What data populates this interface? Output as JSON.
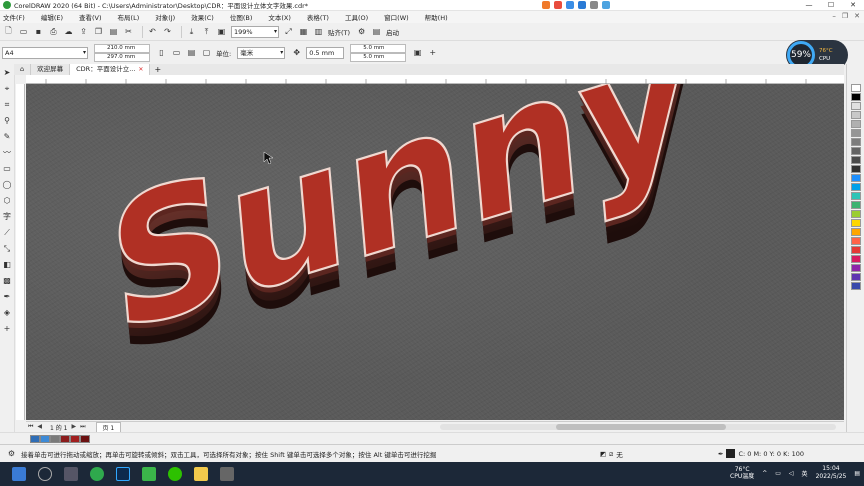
{
  "window": {
    "title": "CorelDRAW 2020 (64 Bit) - C:\\Users\\Administrator\\Desktop\\CDR：平面设计立体文字效果.cdr*",
    "controls": [
      "—",
      "☐",
      "✕"
    ]
  },
  "menu": [
    "文件(F)",
    "编辑(E)",
    "查看(V)",
    "布局(L)",
    "对象(J)",
    "效果(C)",
    "位图(B)",
    "文本(X)",
    "表格(T)",
    "工具(O)",
    "窗口(W)",
    "帮助(H)"
  ],
  "toolbar": {
    "zoom": "199%",
    "snap_label": "贴齐(T)",
    "launch_label": "启动"
  },
  "property_bar": {
    "page_size": "A4",
    "width": "210.0 mm",
    "height": "297.0 mm",
    "units_label": "单位:",
    "units_value": "毫米",
    "nudge": "0.5 mm",
    "dup_x": "5.0 mm",
    "dup_y": "5.0 mm"
  },
  "cpu_widget": {
    "percent": "59%",
    "temp": "76°C",
    "label": "CPU"
  },
  "tabs": [
    {
      "label": "欢迎屏幕"
    },
    {
      "label": "CDR：平面设计立..."
    }
  ],
  "canvas": {
    "artwork_text": "Sunny",
    "text_color": "#b03024",
    "extrude_color": "#3a1c18",
    "background_color": "#5a5a5a"
  },
  "page_nav": {
    "page_counter": "1 的 1",
    "page_tab": "页 1"
  },
  "status": {
    "hint": "接着单击可进行拖动或缩放；再单击可旋转或倾斜；双击工具，可选择所有对象；按住 Shift 键单击可选择多个对象；按住 Alt 键单击可进行挖掘",
    "fill_none": "无",
    "outline_readout": "C: 0 M: 0 Y: 0 K: 100"
  },
  "taskbar": {
    "tray_temp": "76°C",
    "tray_temp_label": "CPU温度",
    "time": "15:04",
    "date": "2022/5/25"
  },
  "palette_colors": [
    "#ffffff",
    "#000000",
    "#e0e0e0",
    "#c8c8c8",
    "#b0b0b0",
    "#969696",
    "#7d7d7d",
    "#646464",
    "#4b4b4b",
    "#323232",
    "#1e90ff",
    "#00a0e9",
    "#2ec4b6",
    "#3cb371",
    "#9acd32",
    "#ffd700",
    "#ffa500",
    "#ff6347",
    "#e53935",
    "#d81b60",
    "#8e24aa",
    "#5e35b1",
    "#3949ab"
  ],
  "strip_colors": [
    "#2f6db5",
    "#3d8ad6",
    "#7a7a7a",
    "#8b1c1c",
    "#a11f1f",
    "#6b1010"
  ]
}
